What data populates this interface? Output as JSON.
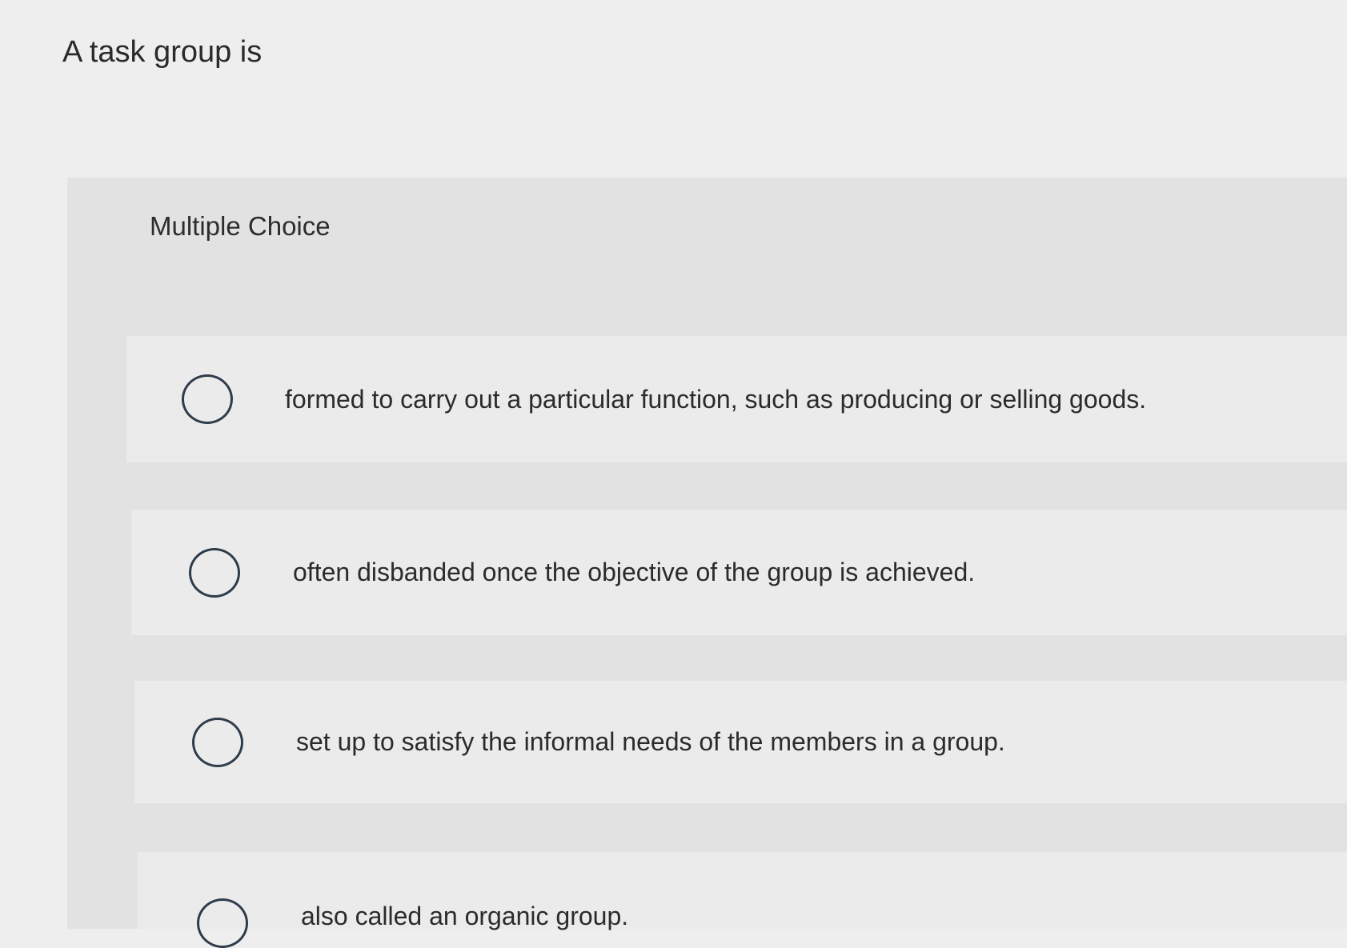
{
  "question": {
    "prompt": "A task group is"
  },
  "multiple_choice": {
    "header": "Multiple Choice",
    "options": [
      {
        "label": "formed to carry out a particular function, such as producing or selling goods.",
        "selected": false
      },
      {
        "label": "often disbanded once the objective of the group is achieved.",
        "selected": false
      },
      {
        "label": "set up to satisfy the informal needs of the members in a group.",
        "selected": false
      },
      {
        "label": "also called an organic group.",
        "selected": false
      }
    ]
  }
}
